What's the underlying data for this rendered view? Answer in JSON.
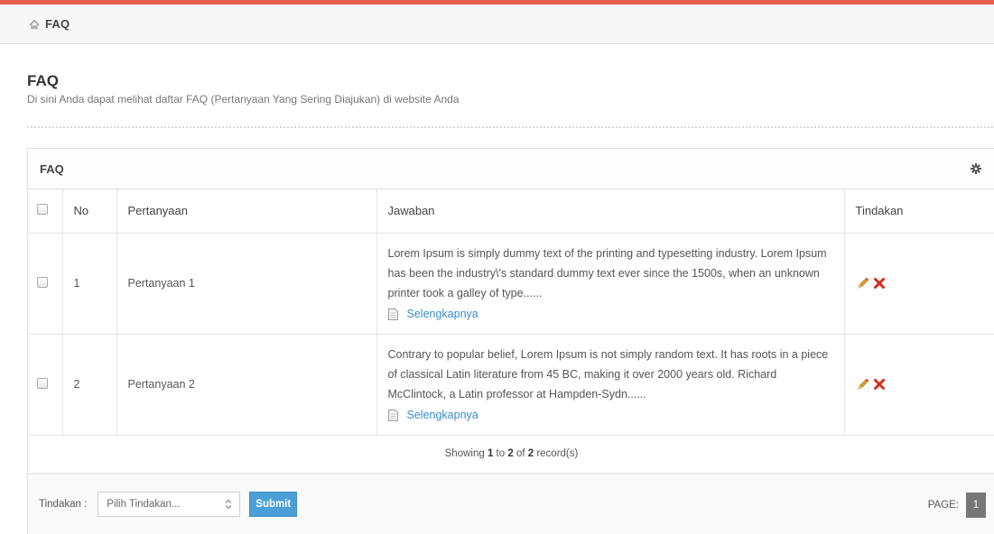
{
  "breadcrumb": {
    "label": "FAQ"
  },
  "header": {
    "title": "FAQ",
    "subtitle": "Di sini Anda dapat melihat daftar FAQ (Pertanyaan Yang Sering Diajukan) di website Anda"
  },
  "panel": {
    "title": "FAQ"
  },
  "table": {
    "columns": [
      "No",
      "Pertanyaan",
      "Jawaban",
      "Tindakan"
    ],
    "rows": [
      {
        "no": "1",
        "question": "Pertanyaan 1",
        "answer": "Lorem Ipsum is simply dummy text of the printing and typesetting industry. Lorem Ipsum has been the industry\\'s standard dummy text ever since the 1500s, when an unknown printer took a galley of type......",
        "more": "Selengkapnya"
      },
      {
        "no": "2",
        "question": "Pertanyaan 2",
        "answer": "Contrary to popular belief, Lorem Ipsum is not simply random text. It has roots in a piece of classical Latin literature from 45 BC, making it over 2000 years old. Richard McClintock, a Latin professor at Hampden-Sydn......",
        "more": "Selengkapnya"
      }
    ],
    "info": {
      "prefix": "Showing ",
      "from": "1",
      "mid": " to ",
      "to": "2",
      "of": " of ",
      "total": "2",
      "suffix": " record(s)"
    }
  },
  "footer": {
    "action_label": "Tindakan :",
    "select_value": "Pilih Tindakan...",
    "submit_label": "Submit",
    "page_label": "PAGE:",
    "current_page": "1"
  },
  "colors": {
    "accent": "#e8604a",
    "link": "#3a8dc5",
    "submit": "#4b9fd6",
    "delete": "#d62b1f",
    "pencil": "#e2a62a"
  }
}
